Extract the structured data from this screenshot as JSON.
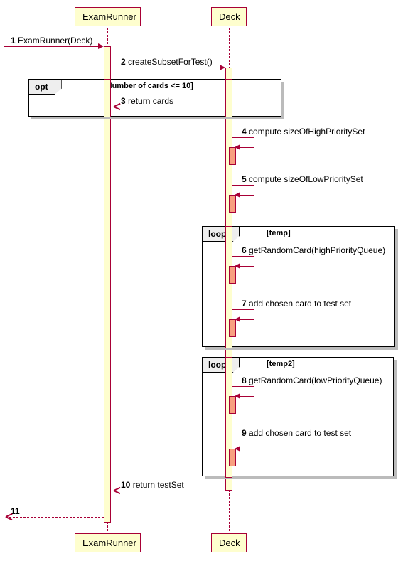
{
  "participants": {
    "p1": "ExamRunner",
    "p2": "Deck"
  },
  "messages": {
    "m1": {
      "num": "1",
      "text": "ExamRunner(Deck)"
    },
    "m2": {
      "num": "2",
      "text": "createSubsetForTest()"
    },
    "m3": {
      "num": "3",
      "text": "return cards"
    },
    "m4": {
      "num": "4",
      "text": "compute sizeOfHighPrioritySet"
    },
    "m5": {
      "num": "5",
      "text": "compute sizeOfLowPrioritySet"
    },
    "m6": {
      "num": "6",
      "text": "getRandomCard(highPriorityQueue)"
    },
    "m7": {
      "num": "7",
      "text": "add chosen card to test set"
    },
    "m8": {
      "num": "8",
      "text": "getRandomCard(lowPriorityQueue)"
    },
    "m9": {
      "num": "9",
      "text": "add chosen card to test set"
    },
    "m10": {
      "num": "10",
      "text": "return testSet"
    },
    "m11": {
      "num": "11",
      "text": ""
    }
  },
  "frames": {
    "opt": {
      "tag": "opt",
      "guard": "[Number of cards <= 10]"
    },
    "loop1": {
      "tag": "loop",
      "guard": "[temp]"
    },
    "loop2": {
      "tag": "loop",
      "guard": "[temp2]"
    }
  }
}
